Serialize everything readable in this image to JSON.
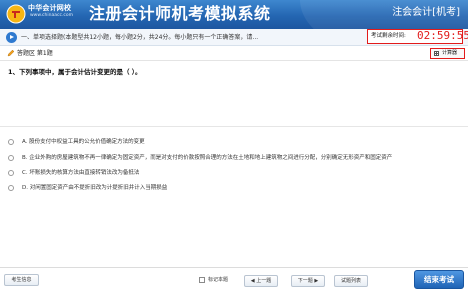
{
  "header": {
    "brand": "中华会计网校",
    "brand_url": "www.chinaacc.com",
    "system_title": "注册会计师机考模拟系统",
    "exam_name": "注会会计[机考]"
  },
  "question_bar": {
    "type_text": "一、单项选择题(本题型共12小题，每小题2分，共24分。每小题只有一个正确答案，请..."
  },
  "timer": {
    "label": "考试剩余时间:",
    "value": "02:59:55"
  },
  "answer_area": {
    "label": "答题区 第1题",
    "calculator_label": "计算器"
  },
  "question": {
    "text": "1、下列事项中，属于会计估计变更的是（ ）。"
  },
  "options": [
    {
      "text": "A. 股份支付中权益工具的公允价值确定方法的变更"
    },
    {
      "text": "B. 企业外购的房屋建筑物不再一律确定为固定资产，而是对支付的价款按照合理的方法在土地和地上建筑物之间进行分配，分别确定无形资产和固定资产"
    },
    {
      "text": "C. 坏账损失的核算方法由直接转销法改为备抵法"
    },
    {
      "text": "D. 对闲置固定资产由不提折旧改为计提折旧并计入当期损益"
    }
  ],
  "footer": {
    "candidate_info": "考生信息",
    "flag_label": "标记本题",
    "prev": "◀ 上一题",
    "next": "下一题 ▶",
    "question_list": "试题列表",
    "submit": "结束考试"
  },
  "colors": {
    "header_blue": "#2466b2",
    "timer_red": "#e21b1b",
    "submit_blue": "#1f63b5"
  }
}
